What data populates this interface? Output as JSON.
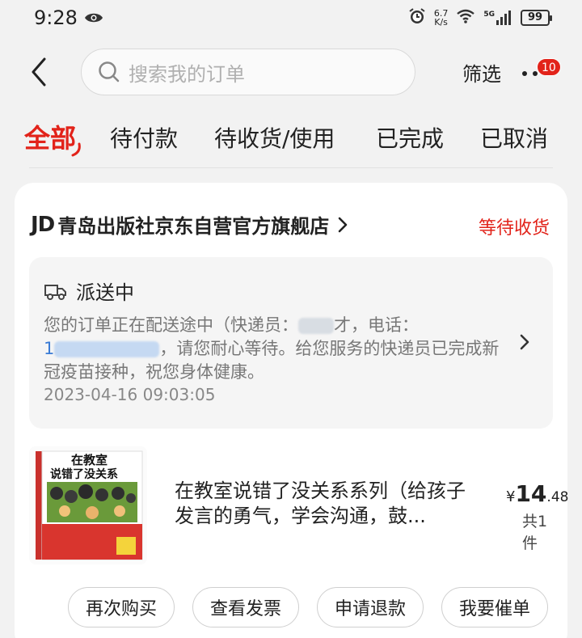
{
  "status_bar": {
    "time": "9:28",
    "net_speed_value": "6.7",
    "net_speed_unit": "K/s",
    "signal_label": "5G",
    "battery": "99"
  },
  "header": {
    "search_placeholder": "搜索我的订单",
    "filter_label": "筛选",
    "more_badge": "10"
  },
  "tabs": [
    {
      "label": "全部",
      "active": true
    },
    {
      "label": "待付款",
      "active": false
    },
    {
      "label": "待收货/使用",
      "active": false
    },
    {
      "label": "已完成",
      "active": false
    },
    {
      "label": "已取消",
      "active": false
    }
  ],
  "order": {
    "shop_logo": "JD",
    "shop_name": "青岛出版社京东自营官方旗舰店",
    "status": "等待收货",
    "delivery": {
      "title": "派送中",
      "message_part1": "您的订单正在配送途中（快递员：",
      "message_part2": "才，电话：",
      "phone_prefix": "1",
      "message_part3": "，请您耐心等待。给您服务的快递员已完成新冠疫苗接种，祝您身体健康。",
      "time": "2023-04-16 09:03:05"
    },
    "product": {
      "title": "在教室说错了没关系系列（给孩子发言的勇气，学会沟通，鼓...",
      "price_currency": "¥",
      "price_integer": "14",
      "price_decimal": ".48",
      "quantity": "共1件",
      "cover_title_line1": "在教室",
      "cover_title_line2": "说错了没关系"
    },
    "actions": [
      {
        "label": "再次购买"
      },
      {
        "label": "查看发票"
      },
      {
        "label": "申请退款"
      },
      {
        "label": "我要催单"
      }
    ]
  },
  "colors": {
    "accent": "#e2231a",
    "background": "#f2f2f2",
    "card": "#ffffff",
    "delivery_box": "#f5f5f5"
  }
}
